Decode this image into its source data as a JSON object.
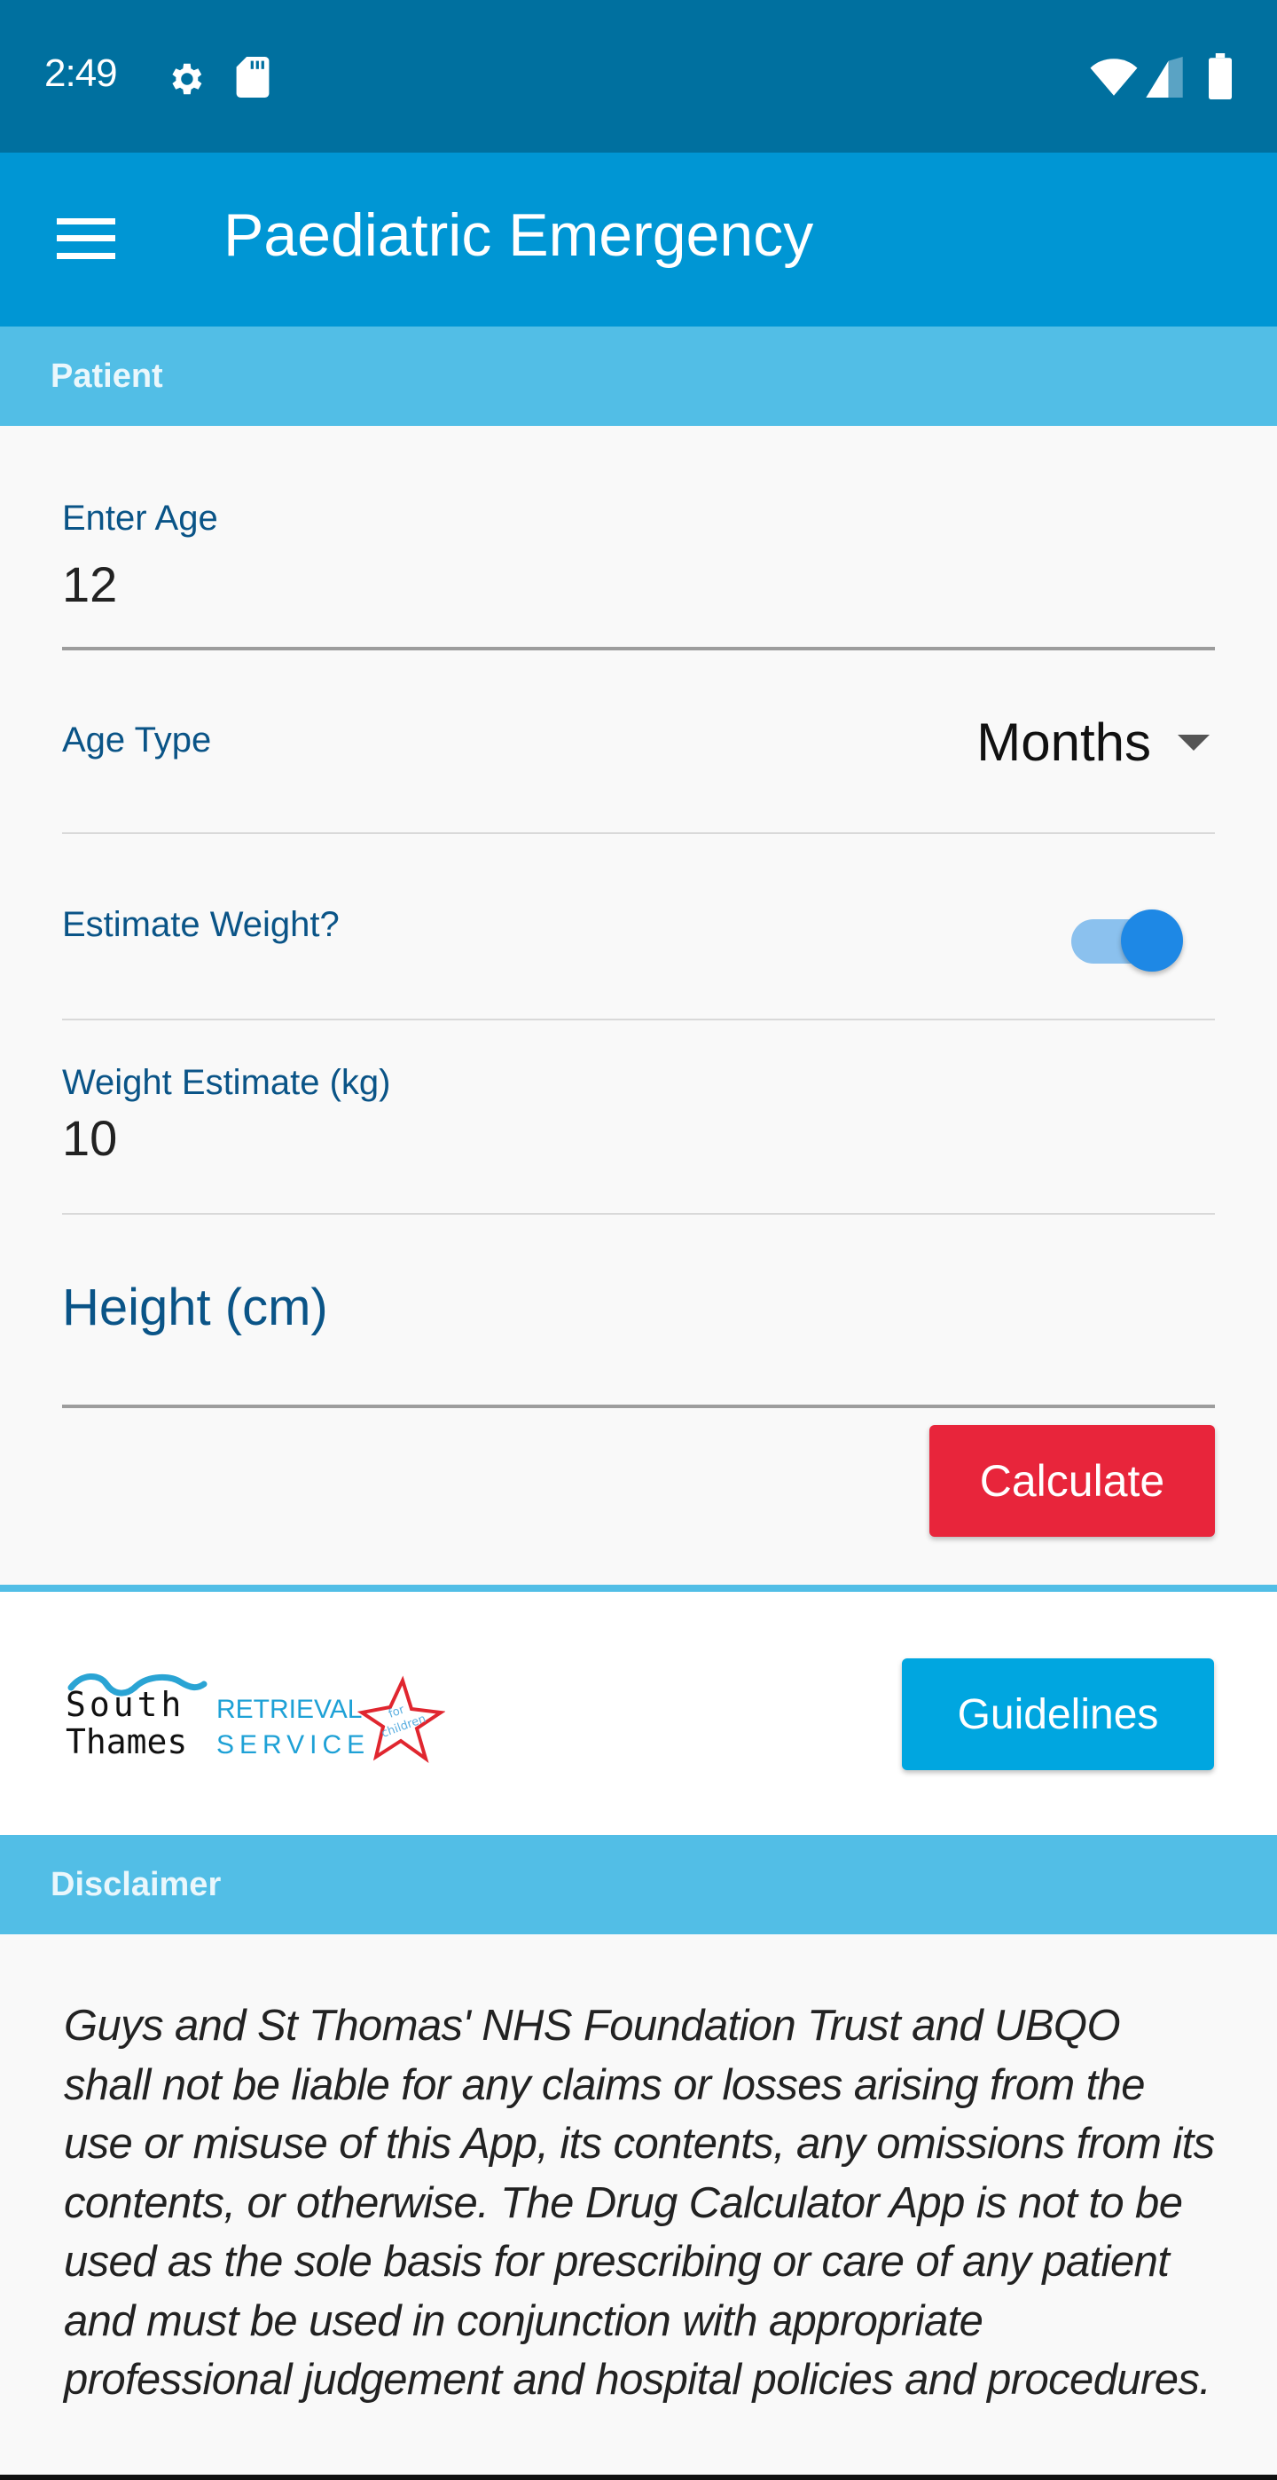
{
  "status_bar": {
    "time": "2:49",
    "icons_left": [
      "gear-icon",
      "sd-card-icon"
    ],
    "icons_right": [
      "wifi-icon",
      "cell-signal-icon",
      "battery-icon"
    ]
  },
  "app_bar": {
    "menu_icon": "hamburger-menu-icon",
    "title": "Paediatric Emergency"
  },
  "patient_section": {
    "header": "Patient",
    "age": {
      "label": "Enter Age",
      "value": "12"
    },
    "age_type": {
      "label": "Age Type",
      "selected": "Months"
    },
    "estimate_weight": {
      "label": "Estimate Weight?",
      "enabled": true
    },
    "weight_estimate": {
      "label": "Weight Estimate (kg)",
      "value": "10"
    },
    "height": {
      "placeholder": "Height (cm)",
      "value": ""
    },
    "calculate_label": "Calculate"
  },
  "logo": {
    "line1": "South",
    "line2": "Thames",
    "retrieval": "RETRIEVAL",
    "service": "SERVICE",
    "star_text_1": "for",
    "star_text_2": "children"
  },
  "guidelines_label": "Guidelines",
  "disclaimer": {
    "header": "Disclaimer",
    "text": "Guys and St Thomas' NHS Foundation Trust and UBQO shall not be liable for any claims or losses arising from the use or misuse of this App, its contents, any omissions from its contents, or otherwise. The Drug Calculator App is not to be used as the sole basis for prescribing or care of any patient and must be used in conjunction with appropriate professional judgement and hospital policies and procedures."
  },
  "colors": {
    "status_bar": "#00709f",
    "app_bar": "#0096d4",
    "section_header": "#52bee6",
    "label_blue": "#0a5487",
    "calculate_red": "#e8253b",
    "guidelines_blue": "#00a6e0",
    "toggle_on": "#1e88e5"
  }
}
